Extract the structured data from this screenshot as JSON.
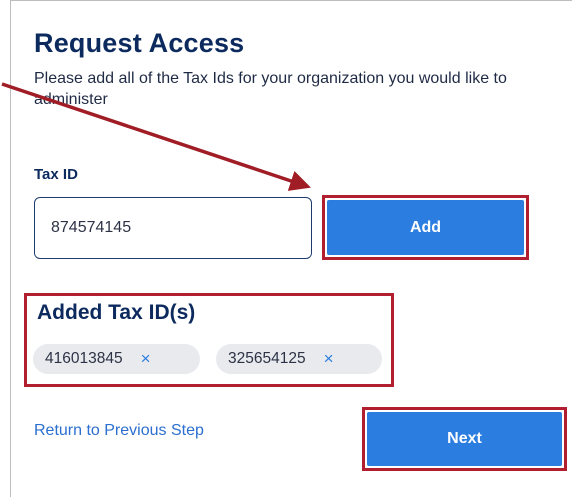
{
  "header": {
    "title": "Request Access",
    "subtitle": "Please add all of the Tax Ids for your organization you would like to administer"
  },
  "tax_id": {
    "label": "Tax ID",
    "value": "874574145",
    "add_label": "Add"
  },
  "added": {
    "title": "Added Tax ID(s)",
    "chips": [
      {
        "value": "416013845",
        "remove": "×"
      },
      {
        "value": "325654125",
        "remove": "×"
      }
    ]
  },
  "footer": {
    "back_link": "Return to Previous Step",
    "next_label": "Next"
  },
  "colors": {
    "accent": "#2b7de0",
    "highlight_outline": "#b01e2f",
    "heading": "#0c2a5e"
  }
}
